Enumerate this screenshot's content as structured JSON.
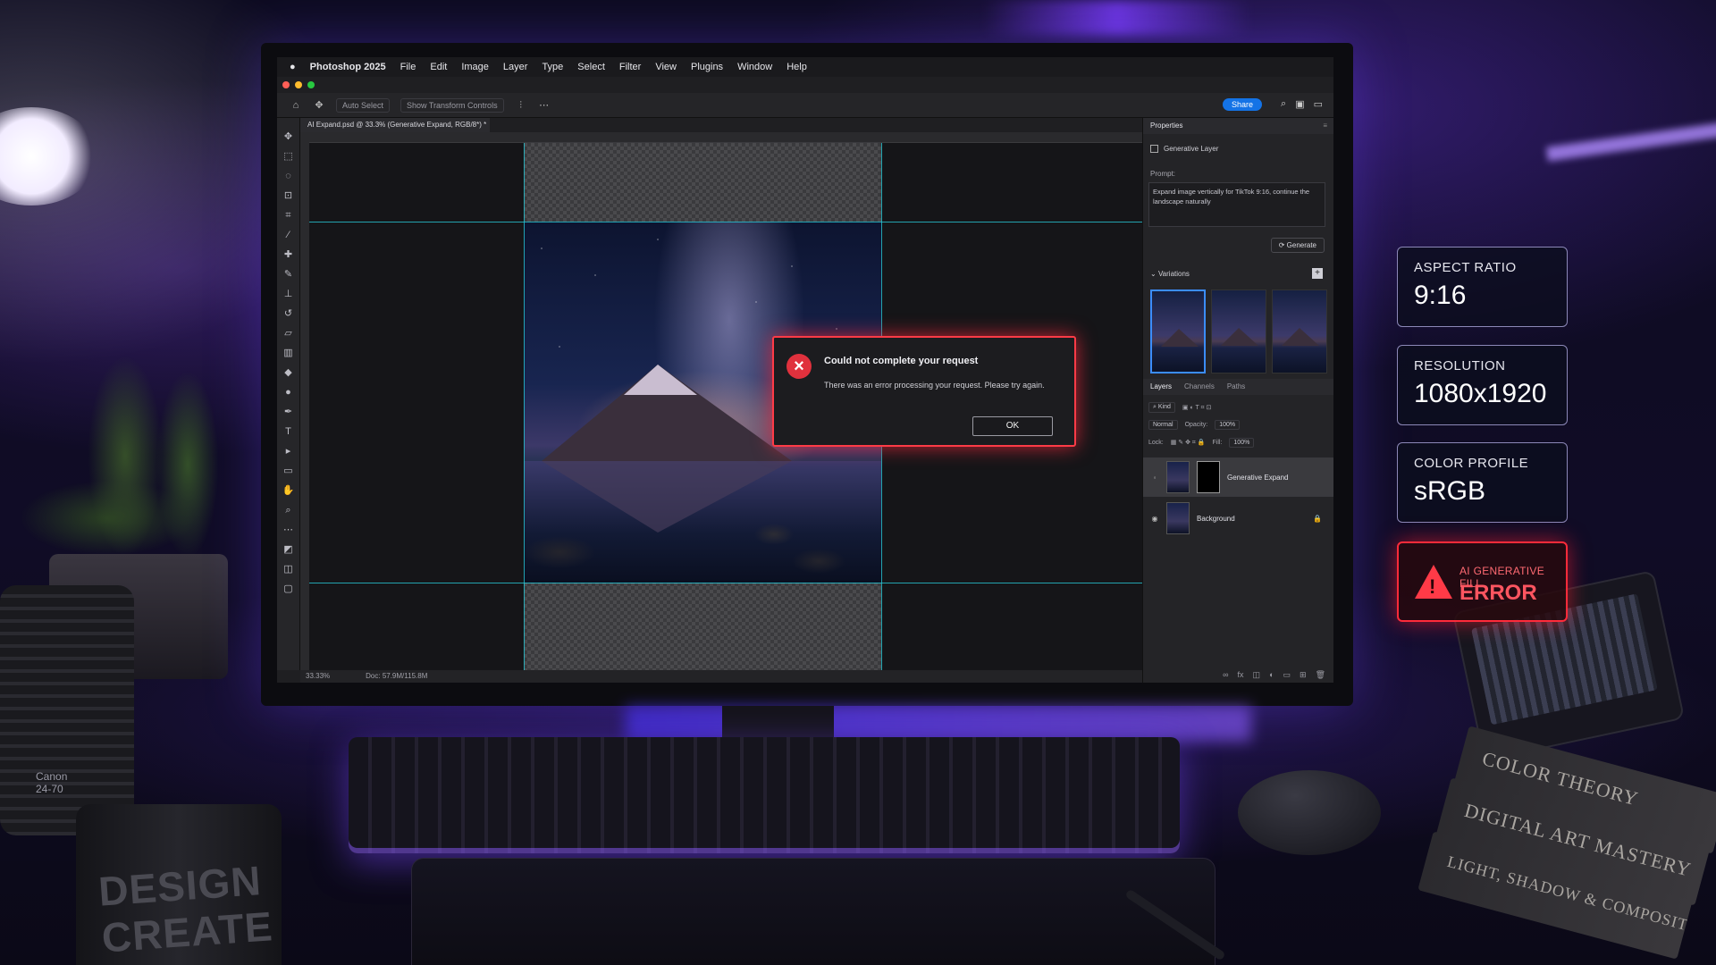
{
  "app": {
    "name": "Photoshop 2025",
    "menu": [
      "File",
      "Edit",
      "Image",
      "Layer",
      "Type",
      "Select",
      "Filter",
      "View",
      "Plugins",
      "Window",
      "Help"
    ]
  },
  "options": {
    "auto_select": "Auto Select",
    "transform": "Show Transform Controls",
    "share": "Share"
  },
  "document": {
    "tab": "AI Expand.psd @ 33.3% (Generative Expand, RGB/8*) *",
    "zoom": "33.33%",
    "doc_size": "Doc: 57.9M/115.8M"
  },
  "dialog": {
    "title": "Could not complete your request",
    "message": "There was an error processing your request. Please try again.",
    "ok": "OK"
  },
  "properties": {
    "header": "Properties",
    "layer_type": "Generative Layer",
    "prompt_label": "Prompt:",
    "prompt_text": "Expand image vertically for TikTok 9:16, continue the landscape naturally",
    "generate": "Generate",
    "variations": "Variations"
  },
  "layers_panel": {
    "tabs": [
      "Layers",
      "Channels",
      "Paths"
    ],
    "kind": "Kind",
    "blend": "Normal",
    "opacity_label": "Opacity:",
    "opacity": "100%",
    "lock_label": "Lock:",
    "fill_label": "Fill:",
    "fill": "100%",
    "layers": [
      {
        "name": "Generative Expand"
      },
      {
        "name": "Background"
      }
    ]
  },
  "cards": {
    "aspect_label": "ASPECT RATIO",
    "aspect_value": "9:16",
    "resolution_label": "RESOLUTION",
    "resolution_value": "1080x1920",
    "profile_label": "COLOR PROFILE",
    "profile_value": "sRGB",
    "error_label": "AI GENERATIVE FILL",
    "error_value": "ERROR"
  },
  "props": {
    "mug_line1": "DESIGN",
    "mug_line2": "CREATE",
    "lens_brand": "Canon",
    "lens_model": "24-70",
    "book1": "COLOR THEORY",
    "book2": "DIGITAL ART MASTERY",
    "book3": "LIGHT, SHADOW & COMPOSITION"
  },
  "colors": {
    "accent_blue": "#1473e6",
    "error_red": "#ff2b3a",
    "guide_cyan": "#27c7d6"
  }
}
